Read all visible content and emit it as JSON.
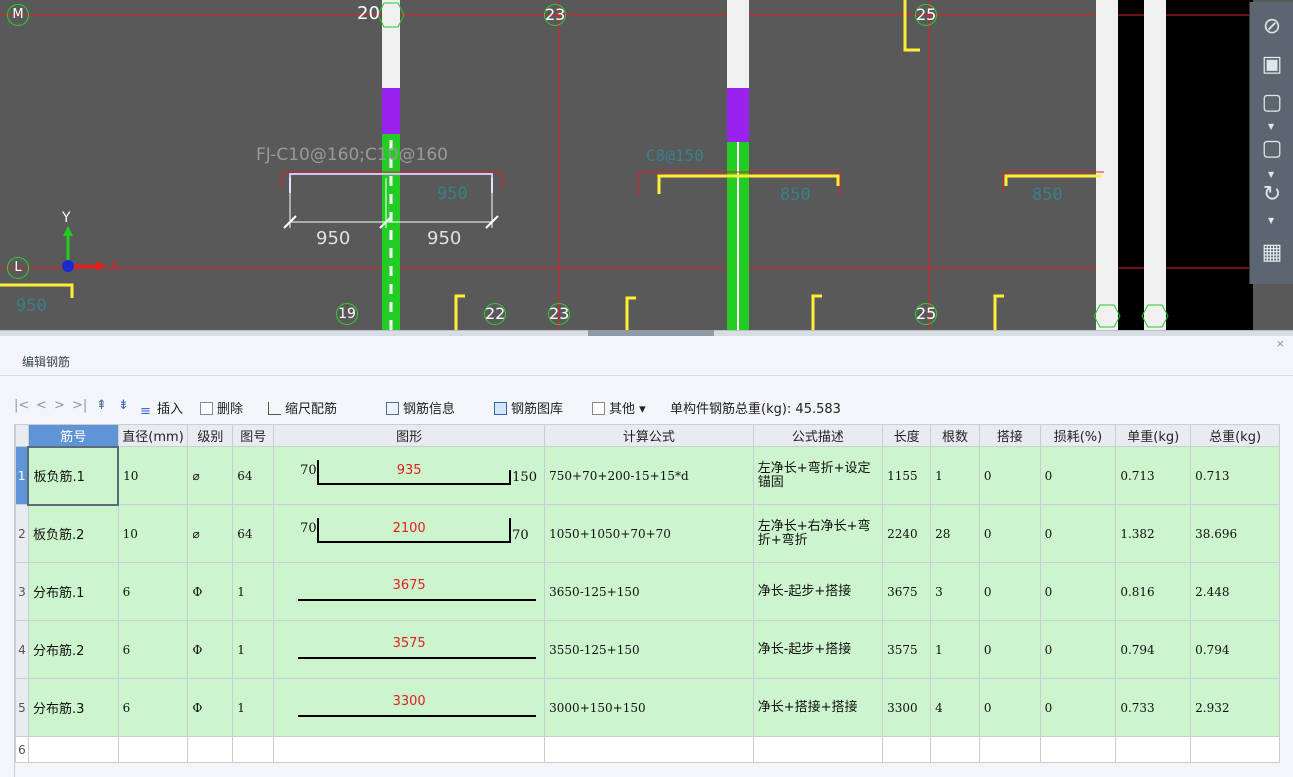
{
  "cad": {
    "axis_top": [
      "M",
      "20",
      "23",
      "25"
    ],
    "axis_bottom": [
      "19",
      "22",
      "23",
      "25"
    ],
    "axis_left": "L",
    "rebar_label_fj": "FJ-C10@160;C10@160",
    "rebar_label_c8": "C8@150",
    "dim_950_a": "950",
    "dim_950_b": "950",
    "dim_950_top": "950",
    "dim_850_a": "850",
    "dim_850_b": "850",
    "dim_950_left": "950",
    "coord_x": "X",
    "coord_y": "Y"
  },
  "panel": {
    "title": "编辑钢筋",
    "close": "×"
  },
  "toolbar": {
    "first": "|<",
    "prev": "<",
    "next": ">",
    "last": ">|",
    "insert": "插入",
    "delete": "删除",
    "scale": "缩尺配筋",
    "info": "钢筋信息",
    "library": "钢筋图库",
    "other": "其他",
    "other_arrow": "▾",
    "total": "单构件钢筋总重(kg): 45.583"
  },
  "table": {
    "headers": [
      "筋号",
      "直径(mm)",
      "级别",
      "图号",
      "图形",
      "计算公式",
      "公式描述",
      "长度",
      "根数",
      "搭接",
      "损耗(%)",
      "单重(kg)",
      "总重(kg)"
    ],
    "rows": [
      {
        "num": "1",
        "name": "板负筋.1",
        "dia": "10",
        "grade": "⌀",
        "fig": "64",
        "left": "70",
        "mid": "935",
        "right": "150",
        "formula": "750+70+200-15+15*d",
        "desc": "左净长+弯折+设定锚固",
        "len": "1155",
        "count": "1",
        "lap": "0",
        "loss": "0",
        "unit": "0.713",
        "total": "0.713"
      },
      {
        "num": "2",
        "name": "板负筋.2",
        "dia": "10",
        "grade": "⌀",
        "fig": "64",
        "left": "70",
        "mid": "2100",
        "right": "70",
        "formula": "1050+1050+70+70",
        "desc": "左净长+右净长+弯折+弯折",
        "len": "2240",
        "count": "28",
        "lap": "0",
        "loss": "0",
        "unit": "1.382",
        "total": "38.696"
      },
      {
        "num": "3",
        "name": "分布筋.1",
        "dia": "6",
        "grade": "Φ",
        "fig": "1",
        "left": "",
        "mid": "3675",
        "right": "",
        "formula": "3650-125+150",
        "desc": "净长-起步+搭接",
        "len": "3675",
        "count": "3",
        "lap": "0",
        "loss": "0",
        "unit": "0.816",
        "total": "2.448"
      },
      {
        "num": "4",
        "name": "分布筋.2",
        "dia": "6",
        "grade": "Φ",
        "fig": "1",
        "left": "",
        "mid": "3575",
        "right": "",
        "formula": "3550-125+150",
        "desc": "净长-起步+搭接",
        "len": "3575",
        "count": "1",
        "lap": "0",
        "loss": "0",
        "unit": "0.794",
        "total": "0.794"
      },
      {
        "num": "5",
        "name": "分布筋.3",
        "dia": "6",
        "grade": "Φ",
        "fig": "1",
        "left": "",
        "mid": "3300",
        "right": "",
        "formula": "3000+150+150",
        "desc": "净长+搭接+搭接",
        "len": "3300",
        "count": "4",
        "lap": "0",
        "loss": "0",
        "unit": "0.733",
        "total": "2.932"
      },
      {
        "num": "6",
        "name": "",
        "dia": "",
        "grade": "",
        "fig": "",
        "left": "",
        "mid": "",
        "right": "",
        "formula": "",
        "desc": "",
        "len": "",
        "count": "",
        "lap": "",
        "loss": "",
        "unit": "",
        "total": ""
      }
    ]
  },
  "colors": {
    "viewport_bg": "#595959",
    "grid_line": "#e02020",
    "axis_bubble": "#2fd12f",
    "row_bg": "#cdf5cd",
    "selected": "#5f94d6",
    "rebar_yellow": "#ffee33",
    "beam_green": "#22cc22",
    "beam_purple": "#9a22ee"
  }
}
